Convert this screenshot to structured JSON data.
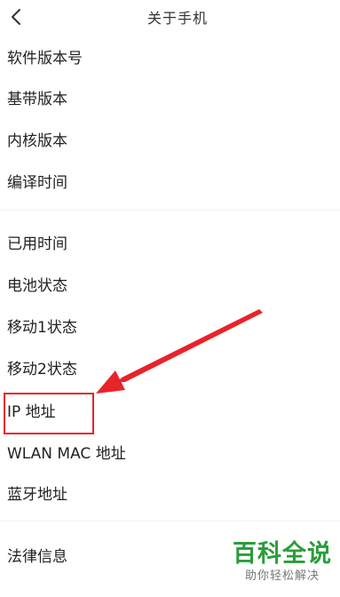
{
  "header": {
    "title": "关于手机",
    "back_icon": "chevron-left-icon"
  },
  "items": [
    {
      "label": "软件版本号"
    },
    {
      "label": "基带版本"
    },
    {
      "label": "内核版本"
    },
    {
      "label": "编译时间"
    },
    {
      "label": "已用时间"
    },
    {
      "label": "电池状态"
    },
    {
      "label": "移动1状态"
    },
    {
      "label": "移动2状态"
    },
    {
      "label": "IP 地址"
    },
    {
      "label": "WLAN MAC 地址"
    },
    {
      "label": "蓝牙地址"
    },
    {
      "label": "法律信息"
    }
  ],
  "annotation": {
    "color": "#e8232a",
    "arrow_icon": "red-arrow-icon"
  },
  "watermark": {
    "brand": "百科全说",
    "slogan": "助你轻松解决",
    "brand_color": "#2a9d3a"
  }
}
